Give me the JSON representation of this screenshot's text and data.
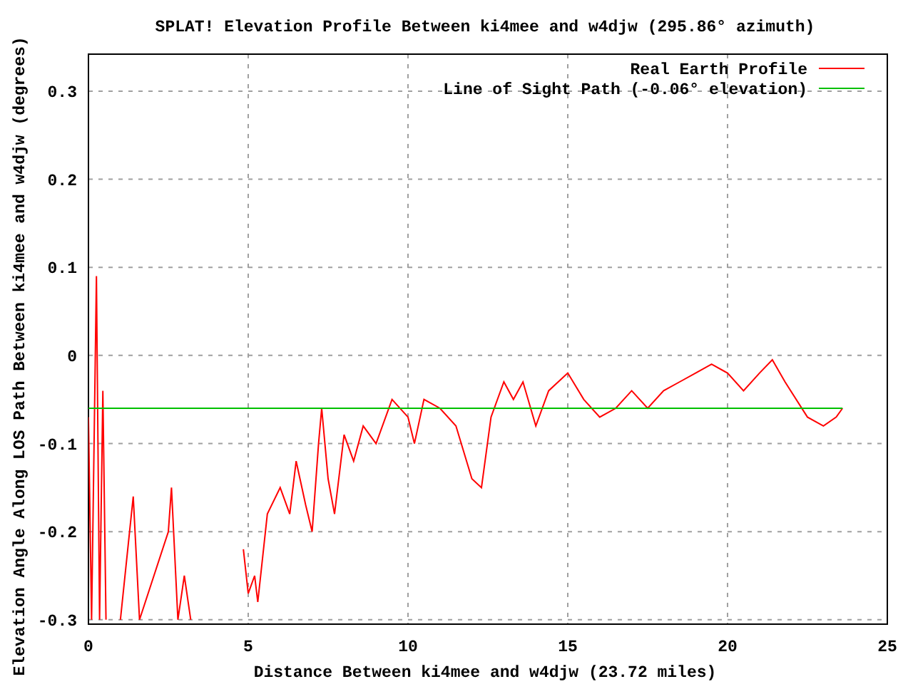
{
  "chart_data": {
    "type": "line",
    "title": "SPLAT! Elevation Profile Between ki4mee and w4djw (295.86° azimuth)",
    "xlabel": "Distance Between ki4mee and w4djw (23.72 miles)",
    "ylabel": "Elevation Angle Along LOS Path Between ki4mee and w4djw (degrees)",
    "x": [
      0,
      0.1,
      0.25,
      0.35,
      0.45,
      0.55,
      0.8,
      1,
      1.4,
      1.6,
      2.5,
      2.6,
      2.8,
      3,
      3.2,
      4.8,
      4.85,
      5,
      5.2,
      5.3,
      5.6,
      6,
      6.3,
      6.5,
      6.8,
      7,
      7.2,
      7.3,
      7.5,
      7.7,
      8,
      8.3,
      8.6,
      9,
      9.5,
      10,
      10.2,
      10.5,
      11,
      11.5,
      12,
      12.3,
      12.6,
      13,
      13.3,
      13.6,
      14,
      14.4,
      15,
      15.5,
      16,
      16.5,
      17,
      17.5,
      18,
      18.5,
      19,
      19.5,
      20,
      20.5,
      21,
      21.4,
      21.8,
      22.5,
      23,
      23.4,
      23.6
    ],
    "series": [
      {
        "name": "Real Earth Profile",
        "color": "#ff0000",
        "values": [
          -0.07,
          -0.3,
          0.09,
          -0.3,
          -0.04,
          -0.3,
          null,
          -0.3,
          -0.16,
          -0.3,
          -0.2,
          -0.15,
          -0.3,
          -0.25,
          -0.3,
          null,
          -0.22,
          -0.27,
          -0.25,
          -0.28,
          -0.18,
          -0.15,
          -0.18,
          -0.12,
          -0.17,
          -0.2,
          -0.1,
          -0.06,
          -0.14,
          -0.18,
          -0.09,
          -0.12,
          -0.08,
          -0.1,
          -0.05,
          -0.07,
          -0.1,
          -0.05,
          -0.06,
          -0.08,
          -0.14,
          -0.15,
          -0.07,
          -0.03,
          -0.05,
          -0.03,
          -0.08,
          -0.04,
          -0.02,
          -0.05,
          -0.07,
          -0.06,
          -0.04,
          -0.06,
          -0.04,
          -0.03,
          -0.02,
          -0.01,
          -0.02,
          -0.04,
          -0.02,
          -0.005,
          -0.03,
          -0.07,
          -0.08,
          -0.07,
          -0.06
        ]
      },
      {
        "name": "Line of Sight Path (-0.06° elevation)",
        "color": "#00c000",
        "values": [
          -0.06,
          -0.06,
          -0.06,
          -0.06,
          -0.06,
          -0.06,
          -0.06,
          -0.06,
          -0.06,
          -0.06,
          -0.06,
          -0.06,
          -0.06,
          -0.06,
          -0.06,
          -0.06,
          -0.06,
          -0.06,
          -0.06,
          -0.06,
          -0.06,
          -0.06,
          -0.06,
          -0.06,
          -0.06,
          -0.06,
          -0.06,
          -0.06,
          -0.06,
          -0.06,
          -0.06,
          -0.06,
          -0.06,
          -0.06,
          -0.06,
          -0.06,
          -0.06,
          -0.06,
          -0.06,
          -0.06,
          -0.06,
          -0.06,
          -0.06,
          -0.06,
          -0.06,
          -0.06,
          -0.06,
          -0.06,
          -0.06,
          -0.06,
          -0.06,
          -0.06,
          -0.06,
          -0.06,
          -0.06,
          -0.06,
          -0.06,
          -0.06,
          -0.06,
          -0.06,
          -0.06,
          -0.06,
          -0.06,
          -0.06,
          -0.06,
          -0.06,
          -0.06
        ]
      }
    ],
    "grid": true,
    "legend": true,
    "xlim": [
      0,
      25
    ],
    "ylim": [
      -0.305,
      0.342
    ],
    "xticks": [
      0,
      5,
      10,
      15,
      20,
      25
    ],
    "yticks": [
      -0.3,
      -0.2,
      -0.1,
      0,
      0.1,
      0.2,
      0.3
    ]
  }
}
